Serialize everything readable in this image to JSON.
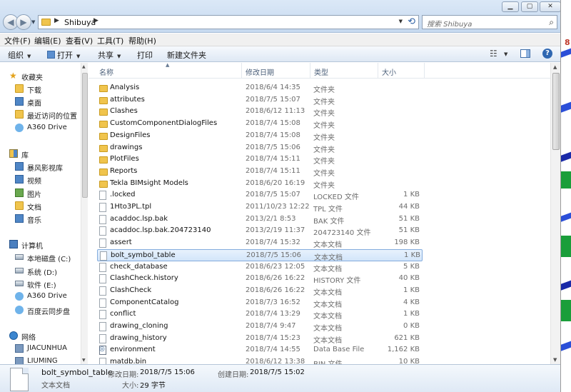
{
  "window": {
    "controls": [
      "▁",
      "▢",
      "✕"
    ]
  },
  "address": {
    "path": "Shibuya",
    "search_placeholder": "搜索 Shibuya"
  },
  "menu": [
    "文件(F)",
    "编辑(E)",
    "查看(V)",
    "工具(T)",
    "帮助(H)"
  ],
  "toolbar": {
    "organize": "组织",
    "open": "打开",
    "share": "共享",
    "print": "打印",
    "new_folder": "新建文件夹"
  },
  "nav": {
    "favorites": "收藏夹",
    "downloads": "下载",
    "desktop": "桌面",
    "recent": "最近访问的位置",
    "a360_fav": "A360 Drive",
    "libraries": "库",
    "videos_lib": "暴风影视库",
    "video": "视频",
    "pictures": "图片",
    "documents": "文档",
    "music": "音乐",
    "computer": "计算机",
    "drive_c": "本地磁盘 (C:)",
    "drive_d": "系统 (D:)",
    "drive_e": "软件 (E:)",
    "a360_pc": "A360 Drive",
    "baidu": "百度云同步盘",
    "network": "网络",
    "pc1": "JIACUNHUA",
    "pc2": "LIUMING"
  },
  "columns": {
    "name": "名称",
    "date": "修改日期",
    "type": "类型",
    "size": "大小"
  },
  "files": [
    {
      "name": "Analysis",
      "date": "2018/6/4 14:35",
      "type": "文件夹",
      "size": "",
      "kind": "folder"
    },
    {
      "name": "attributes",
      "date": "2018/7/5 15:07",
      "type": "文件夹",
      "size": "",
      "kind": "folder"
    },
    {
      "name": "Clashes",
      "date": "2018/6/12 11:13",
      "type": "文件夹",
      "size": "",
      "kind": "folder"
    },
    {
      "name": "CustomComponentDialogFiles",
      "date": "2018/7/4 15:08",
      "type": "文件夹",
      "size": "",
      "kind": "folder"
    },
    {
      "name": "DesignFiles",
      "date": "2018/7/4 15:08",
      "type": "文件夹",
      "size": "",
      "kind": "folder"
    },
    {
      "name": "drawings",
      "date": "2018/7/5 15:06",
      "type": "文件夹",
      "size": "",
      "kind": "folder"
    },
    {
      "name": "PlotFiles",
      "date": "2018/7/4 15:11",
      "type": "文件夹",
      "size": "",
      "kind": "folder"
    },
    {
      "name": "Reports",
      "date": "2018/7/4 15:11",
      "type": "文件夹",
      "size": "",
      "kind": "folder"
    },
    {
      "name": "Tekla BIMsight Models",
      "date": "2018/6/20 16:19",
      "type": "文件夹",
      "size": "",
      "kind": "folder"
    },
    {
      "name": ".locked",
      "date": "2018/7/5 15:07",
      "type": "LOCKED 文件",
      "size": "1 KB",
      "kind": "file"
    },
    {
      "name": "1Hto3PL.tpl",
      "date": "2011/10/23 12:22",
      "type": "TPL 文件",
      "size": "44 KB",
      "kind": "file"
    },
    {
      "name": "acaddoc.lsp.bak",
      "date": "2013/2/1 8:53",
      "type": "BAK 文件",
      "size": "51 KB",
      "kind": "file"
    },
    {
      "name": "acaddoc.lsp.bak.204723140",
      "date": "2013/2/19 11:37",
      "type": "204723140 文件",
      "size": "51 KB",
      "kind": "file"
    },
    {
      "name": "assert",
      "date": "2018/7/4 15:32",
      "type": "文本文档",
      "size": "198 KB",
      "kind": "file"
    },
    {
      "name": "bolt_symbol_table",
      "date": "2018/7/5 15:06",
      "type": "文本文档",
      "size": "1 KB",
      "kind": "file",
      "selected": true
    },
    {
      "name": "check_database",
      "date": "2018/6/23 12:05",
      "type": "文本文档",
      "size": "5 KB",
      "kind": "file"
    },
    {
      "name": "ClashCheck.history",
      "date": "2018/6/26 16:22",
      "type": "HISTORY 文件",
      "size": "40 KB",
      "kind": "file"
    },
    {
      "name": "ClashCheck",
      "date": "2018/6/26 16:22",
      "type": "文本文档",
      "size": "1 KB",
      "kind": "file"
    },
    {
      "name": "ComponentCatalog",
      "date": "2018/7/3 16:52",
      "type": "文本文档",
      "size": "4 KB",
      "kind": "file"
    },
    {
      "name": "conflict",
      "date": "2018/7/4 13:29",
      "type": "文本文档",
      "size": "1 KB",
      "kind": "file"
    },
    {
      "name": "drawing_cloning",
      "date": "2018/7/4 9:47",
      "type": "文本文档",
      "size": "0 KB",
      "kind": "file"
    },
    {
      "name": "drawing_history",
      "date": "2018/7/4 15:23",
      "type": "文本文档",
      "size": "621 KB",
      "kind": "file"
    },
    {
      "name": "environment",
      "date": "2018/7/4 14:55",
      "type": "Data Base File",
      "size": "1,162 KB",
      "kind": "db"
    },
    {
      "name": "matdb.bin",
      "date": "2018/6/12 13:38",
      "type": "BIN 文件",
      "size": "10 KB",
      "kind": "file"
    }
  ],
  "details": {
    "name": "bolt_symbol_table",
    "type": "文本文档",
    "modified_label": "修改日期:",
    "modified_value": "2018/7/5 15:06",
    "created_label": "创建日期:",
    "created_value": "2018/7/5 15:02",
    "size_label": "大小:",
    "size_value": "29 字节"
  },
  "background_app": {
    "text": "8",
    "colors": [
      "#2b4fd8",
      "#1a9e3a",
      "#1a2aa8"
    ]
  }
}
